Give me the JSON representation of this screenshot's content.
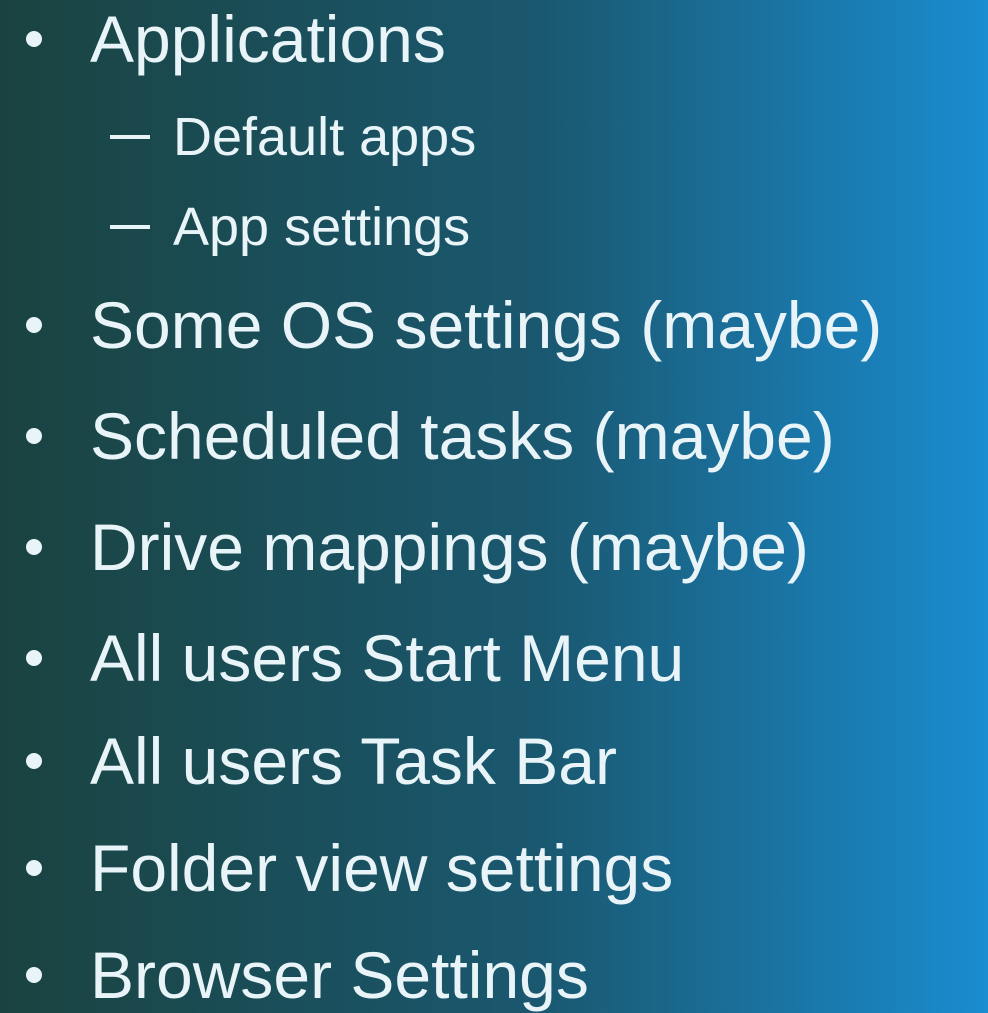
{
  "background": {
    "left_color": "#1a4340",
    "mid_color": "#1a5870",
    "right_color": "#1a8cd0"
  },
  "text_color": "#e8f4f8",
  "items": [
    {
      "label": "Applications",
      "level": 1
    },
    {
      "label": "Default apps",
      "level": 2
    },
    {
      "label": "App settings",
      "level": 2
    },
    {
      "label": "Some OS settings (maybe)",
      "level": 1
    },
    {
      "label": "Scheduled tasks (maybe)",
      "level": 1
    },
    {
      "label": "Drive mappings (maybe)",
      "level": 1
    },
    {
      "label": "All users Start Menu",
      "level": 1
    },
    {
      "label": "All users Task Bar",
      "level": 1
    },
    {
      "label": "Folder view settings",
      "level": 1
    },
    {
      "label": "Browser Settings",
      "level": 1
    }
  ]
}
